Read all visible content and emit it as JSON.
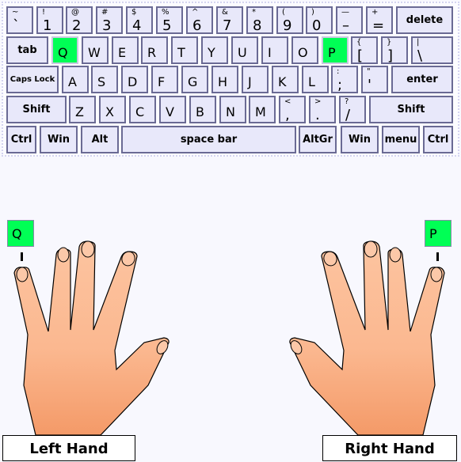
{
  "keyboard": {
    "rows": [
      [
        {
          "top": "~",
          "main": "`"
        },
        {
          "top": "!",
          "main": "1"
        },
        {
          "top": "@",
          "main": "2"
        },
        {
          "top": "#",
          "main": "3"
        },
        {
          "top": "$",
          "main": "4"
        },
        {
          "top": "%",
          "main": "5"
        },
        {
          "top": "^",
          "main": "6"
        },
        {
          "top": "&",
          "main": "7"
        },
        {
          "top": "*",
          "main": "8"
        },
        {
          "top": "(",
          "main": "9"
        },
        {
          "top": ")",
          "main": "0"
        },
        {
          "top": "—",
          "main": "–"
        },
        {
          "top": "+",
          "main": "="
        },
        {
          "label": "delete"
        }
      ],
      [
        {
          "label": "tab"
        },
        {
          "main": "Q",
          "highlight": true
        },
        {
          "main": "W"
        },
        {
          "main": "E"
        },
        {
          "main": "R"
        },
        {
          "main": "T"
        },
        {
          "main": "Y"
        },
        {
          "main": "U"
        },
        {
          "main": "I"
        },
        {
          "main": "O"
        },
        {
          "main": "P",
          "highlight": true
        },
        {
          "top": "{",
          "main": "["
        },
        {
          "top": "}",
          "main": "]"
        },
        {
          "top": "|",
          "main": "\\"
        }
      ],
      [
        {
          "label": "Caps Lock"
        },
        {
          "main": "A"
        },
        {
          "main": "S"
        },
        {
          "main": "D"
        },
        {
          "main": "F"
        },
        {
          "main": "G"
        },
        {
          "main": "H"
        },
        {
          "main": "J"
        },
        {
          "main": "K"
        },
        {
          "main": "L"
        },
        {
          "top": ":",
          "main": ";"
        },
        {
          "top": "\"",
          "main": "'"
        },
        {
          "label": "enter"
        }
      ],
      [
        {
          "label": "Shift"
        },
        {
          "main": "Z"
        },
        {
          "main": "X"
        },
        {
          "main": "C"
        },
        {
          "main": "V"
        },
        {
          "main": "B"
        },
        {
          "main": "N"
        },
        {
          "main": "M"
        },
        {
          "top": "<",
          "main": ","
        },
        {
          "top": ">",
          "main": "."
        },
        {
          "top": "?",
          "main": "/"
        },
        {
          "label": "Shift"
        }
      ],
      [
        {
          "label": "Ctrl"
        },
        {
          "label": "Win"
        },
        {
          "label": "Alt"
        },
        {
          "label": "space bar"
        },
        {
          "label": "AltGr"
        },
        {
          "label": "Win"
        },
        {
          "label": "menu"
        },
        {
          "label": "Ctrl"
        }
      ]
    ]
  },
  "hands": {
    "left": {
      "label": "Left Hand",
      "target_key": "Q"
    },
    "right": {
      "label": "Right Hand",
      "target_key": "P"
    }
  },
  "colors": {
    "highlight": "#00ff55",
    "key": "#e8e8fa",
    "skin": "#fbb890"
  }
}
